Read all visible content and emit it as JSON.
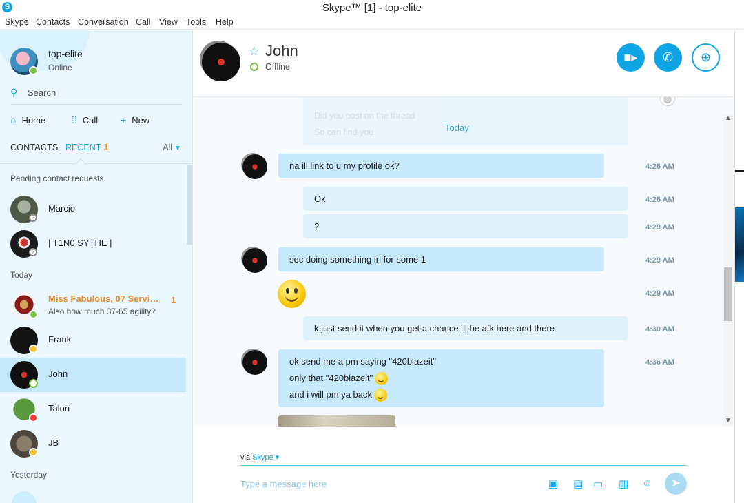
{
  "window": {
    "title": "Skype™ [1] - top-elite",
    "app_icon": "skype-icon"
  },
  "menu": [
    "Skype",
    "Contacts",
    "Conversation",
    "Call",
    "View",
    "Tools",
    "Help"
  ],
  "profile": {
    "name": "top-elite",
    "status": "Online"
  },
  "search": {
    "label": "Search"
  },
  "nav": {
    "home": "Home",
    "call": "Call",
    "new": "New"
  },
  "tabs": {
    "contacts": "CONTACTS",
    "recent": "RECENT",
    "recent_count": "1",
    "filter": "All"
  },
  "sections": {
    "pending": "Pending contact requests",
    "today": "Today",
    "yesterday": "Yesterday"
  },
  "contacts": [
    {
      "name": "Marcio",
      "status": "pending"
    },
    {
      "name": "| T1N0 SYTHE |",
      "status": "pending"
    },
    {
      "name": "Miss Fabulous, 07 Servic...",
      "sub": "Also how much 37-65 agility?",
      "unread": "1",
      "status": "online"
    },
    {
      "name": "Frank",
      "status": "away"
    },
    {
      "name": "John",
      "status": "offline",
      "selected": true
    },
    {
      "name": "Talon",
      "status": "do-not-disturb"
    },
    {
      "name": "JB",
      "status": "away"
    }
  ],
  "conversation": {
    "contact_name": "John",
    "contact_status": "Offline",
    "faded_lines": [
      "Did you post on the thread",
      "So can find you"
    ],
    "date_divider": "Today",
    "messages": [
      {
        "from": "John",
        "lines": [
          "na ill link to u my profile ok?"
        ],
        "time": "4:26 AM"
      },
      {
        "from": "me",
        "lines": [
          "Ok"
        ],
        "time": "4:26 AM"
      },
      {
        "from": "me",
        "lines": [
          "?"
        ],
        "time": "4:29 AM"
      },
      {
        "from": "John",
        "lines": [
          "sec doing something irl for some 1"
        ],
        "time": "4:29 AM"
      },
      {
        "from": "John",
        "emoticon": "smile",
        "time": "4:29 AM"
      },
      {
        "from": "me",
        "lines": [
          "k just send it when you get a chance ill be afk here and there"
        ],
        "time": "4:30 AM"
      },
      {
        "from": "John",
        "lines": [
          "ok send me a pm saying \"420blazeit\"",
          "only that \"420blazeit\"",
          "and i will pm ya back"
        ],
        "time": "4:36 AM"
      }
    ]
  },
  "composer": {
    "via_prefix": "via",
    "via_service": "Skype",
    "placeholder": "Type a message here"
  },
  "colors": {
    "accent": "#0fa5e5",
    "unread": "#f08a1e",
    "sidebar_bg": "#eaf7fe",
    "selected_row": "#c5e9fb"
  }
}
